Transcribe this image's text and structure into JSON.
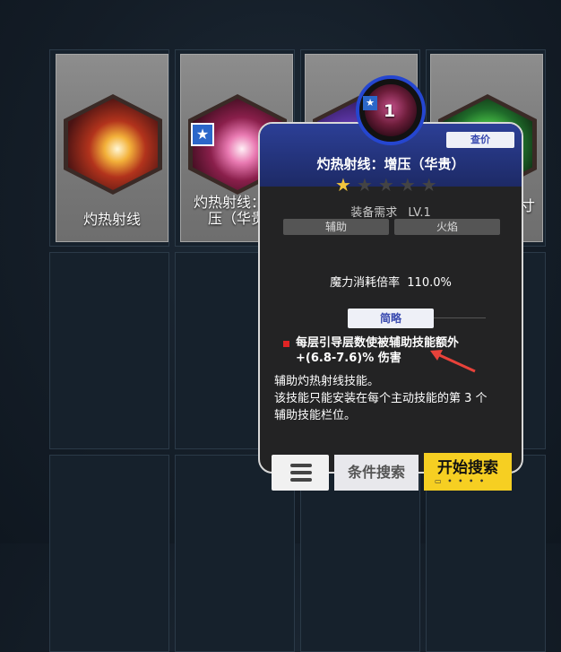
{
  "cards": [
    {
      "label": "灼热射线",
      "starred": false
    },
    {
      "label": "灼热射线：增\n压（华贵",
      "starred": true
    },
    {
      "label": "",
      "starred": false
    },
    {
      "label": "寸",
      "starred": false
    }
  ],
  "popup": {
    "level": "1",
    "price_button": "查价",
    "title": "灼热射线：增压（华贵）",
    "stars_filled": 1,
    "stars_total": 5,
    "requirement_label": "装备需求",
    "requirement_value": "LV.1",
    "tags": [
      "辅助",
      "火焰"
    ],
    "mana_label": "魔力消耗倍率",
    "mana_value": "110.0%",
    "brief_tab": "简略",
    "bullet_line1": "每层引导层数使被辅助技能额外",
    "bullet_line2": "+(6.8-7.6)% 伤害",
    "desc": [
      "辅助灼热射线技能。",
      "该技能只能安装在每个主动技能的第 3 个",
      "辅助技能栏位。"
    ]
  },
  "buttons": {
    "menu_icon": "hamburger-icon",
    "condition_search": "条件搜索",
    "start_search": "开始搜索"
  },
  "colors": {
    "accent_blue": "#2546d0",
    "start_yellow": "#f6cf22",
    "bullet_red": "#e02424",
    "star_gold": "#f2c53d"
  }
}
